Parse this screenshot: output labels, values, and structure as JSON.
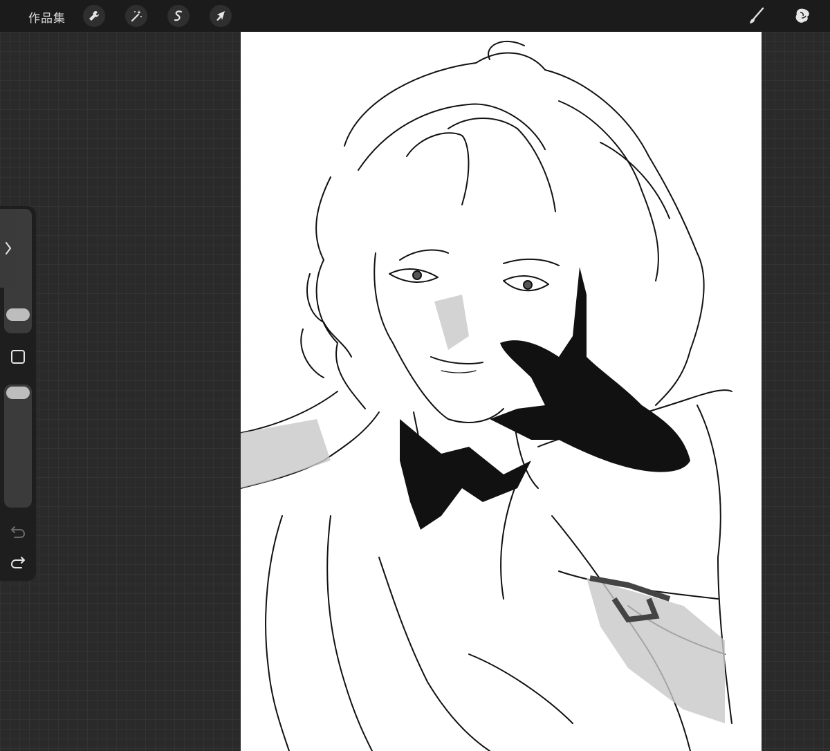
{
  "toolbar": {
    "gallery_label": "作品集",
    "left_tools": [
      {
        "name": "actions",
        "icon": "wrench-icon"
      },
      {
        "name": "adjustments",
        "icon": "magic-wand-icon"
      },
      {
        "name": "selection",
        "icon": "selection-s-icon"
      },
      {
        "name": "transform",
        "icon": "arrow-cursor-icon"
      }
    ],
    "right_tools": [
      {
        "name": "brush",
        "icon": "brush-icon"
      },
      {
        "name": "smudge",
        "icon": "smudge-icon"
      }
    ]
  },
  "sidebar": {
    "tab_icon": "chevron-right-icon",
    "brush_size_level": 0.05,
    "opacity_level": 0.05,
    "modify_icon": "square-icon",
    "undo_icon": "undo-icon",
    "redo_icon": "redo-icon"
  },
  "colors": {
    "topbar": "#1b1b1b",
    "background": "#2a2a2a",
    "canvas": "#ffffff",
    "icon": "#e6e6e6"
  }
}
